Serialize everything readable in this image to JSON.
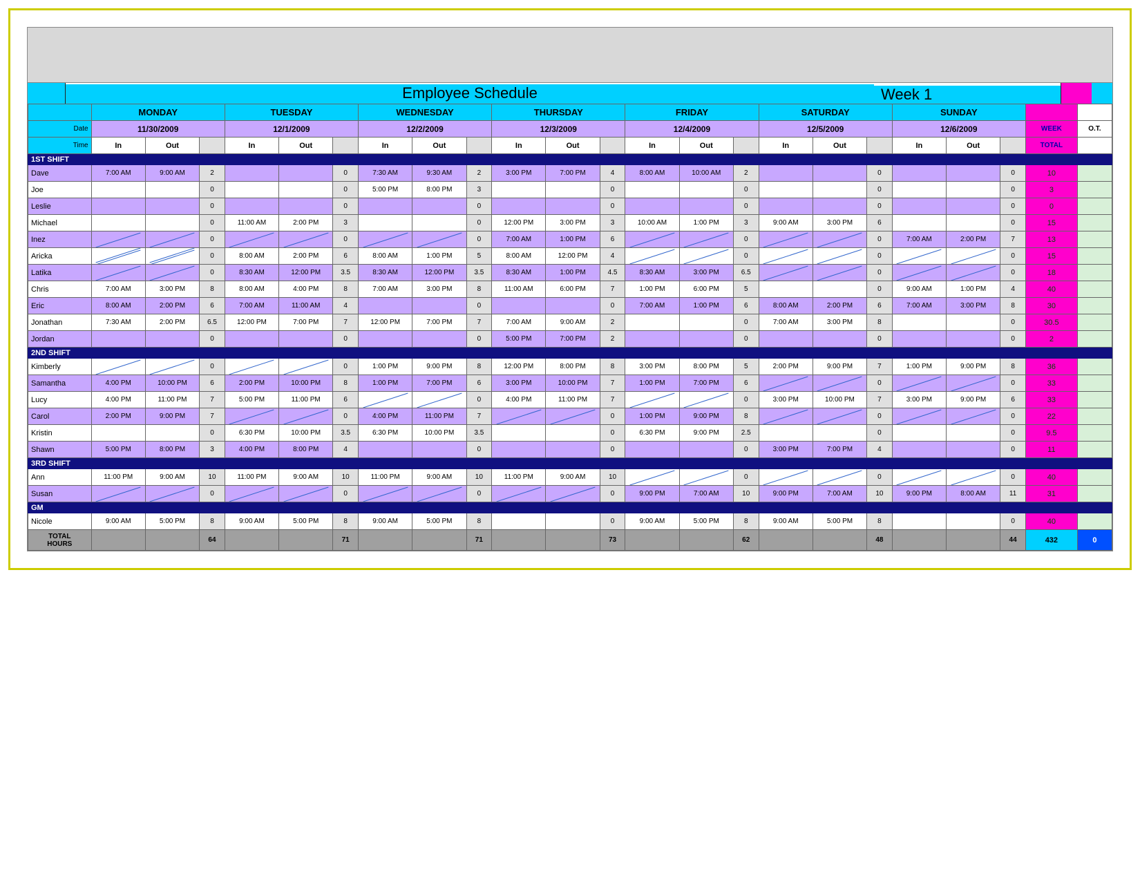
{
  "title": "Employee Schedule",
  "week_label": "Week 1",
  "labels": {
    "date": "Date",
    "time": "Time",
    "in": "In",
    "out": "Out",
    "week": "WEEK",
    "total": "TOTAL",
    "ot": "O.T.",
    "total_hours": "TOTAL HOURS"
  },
  "days": [
    {
      "name": "MONDAY",
      "date": "11/30/2009"
    },
    {
      "name": "TUESDAY",
      "date": "12/1/2009"
    },
    {
      "name": "WEDNESDAY",
      "date": "12/2/2009"
    },
    {
      "name": "THURSDAY",
      "date": "12/3/2009"
    },
    {
      "name": "FRIDAY",
      "date": "12/4/2009"
    },
    {
      "name": "SATURDAY",
      "date": "12/5/2009"
    },
    {
      "name": "SUNDAY",
      "date": "12/6/2009"
    }
  ],
  "shifts": [
    {
      "name": "1ST SHIFT",
      "rows": [
        {
          "name": "Dave",
          "cells": [
            [
              "7:00 AM",
              "9:00 AM",
              "2"
            ],
            [
              "",
              "",
              "0"
            ],
            [
              "7:30 AM",
              "9:30 AM",
              "2"
            ],
            [
              "3:00 PM",
              "7:00 PM",
              "4"
            ],
            [
              "8:00 AM",
              "10:00 AM",
              "2"
            ],
            [
              "",
              "",
              "0"
            ],
            [
              "",
              "",
              "0"
            ]
          ],
          "total": "10"
        },
        {
          "name": "Joe",
          "cells": [
            [
              "",
              "",
              "0"
            ],
            [
              "",
              "",
              "0"
            ],
            [
              "5:00 PM",
              "8:00 PM",
              "3"
            ],
            [
              "",
              "",
              "0"
            ],
            [
              "",
              "",
              "0"
            ],
            [
              "",
              "",
              "0"
            ],
            [
              "",
              "",
              "0"
            ]
          ],
          "total": "3"
        },
        {
          "name": "Leslie",
          "cells": [
            [
              "",
              "",
              "0"
            ],
            [
              "",
              "",
              "0"
            ],
            [
              "",
              "",
              "0"
            ],
            [
              "",
              "",
              "0"
            ],
            [
              "",
              "",
              "0"
            ],
            [
              "",
              "",
              "0"
            ],
            [
              "",
              "",
              "0"
            ]
          ],
          "total": "0"
        },
        {
          "name": "Michael",
          "cells": [
            [
              "",
              "",
              "0"
            ],
            [
              "11:00 AM",
              "2:00 PM",
              "3"
            ],
            [
              "",
              "",
              "0"
            ],
            [
              "12:00 PM",
              "3:00 PM",
              "3"
            ],
            [
              "10:00 AM",
              "1:00 PM",
              "3"
            ],
            [
              "9:00 AM",
              "3:00 PM",
              "6"
            ],
            [
              "",
              "",
              "0"
            ]
          ],
          "total": "15"
        },
        {
          "name": "Inez",
          "cells": [
            [
              "/",
              "/",
              "0"
            ],
            [
              "/",
              "/",
              "0"
            ],
            [
              "/",
              "/",
              "0"
            ],
            [
              "7:00 AM",
              "1:00 PM",
              "6"
            ],
            [
              "/",
              "/",
              "0"
            ],
            [
              "/",
              "/",
              "0"
            ],
            [
              "7:00 AM",
              "2:00 PM",
              "7"
            ]
          ],
          "total": "13"
        },
        {
          "name": "Aricka",
          "cells": [
            [
              "//",
              "//",
              "0"
            ],
            [
              "8:00 AM",
              "2:00 PM",
              "6"
            ],
            [
              "8:00 AM",
              "1:00 PM",
              "5"
            ],
            [
              "8:00 AM",
              "12:00 PM",
              "4"
            ],
            [
              "/",
              "/",
              "0"
            ],
            [
              "/",
              "/",
              "0"
            ],
            [
              "/",
              "/",
              "0"
            ]
          ],
          "total": "15"
        },
        {
          "name": "Latika",
          "cells": [
            [
              "/",
              "/",
              "0"
            ],
            [
              "8:30 AM",
              "12:00 PM",
              "3.5"
            ],
            [
              "8:30 AM",
              "12:00 PM",
              "3.5"
            ],
            [
              "8:30 AM",
              "1:00 PM",
              "4.5"
            ],
            [
              "8:30 AM",
              "3:00 PM",
              "6.5"
            ],
            [
              "/",
              "/",
              "0"
            ],
            [
              "/",
              "/",
              "0"
            ]
          ],
          "total": "18"
        },
        {
          "name": "Chris",
          "cells": [
            [
              "7:00 AM",
              "3:00 PM",
              "8"
            ],
            [
              "8:00 AM",
              "4:00 PM",
              "8"
            ],
            [
              "7:00 AM",
              "3:00 PM",
              "8"
            ],
            [
              "11:00 AM",
              "6:00 PM",
              "7"
            ],
            [
              "1:00 PM",
              "6:00 PM",
              "5"
            ],
            [
              "",
              "",
              "0"
            ],
            [
              "9:00 AM",
              "1:00 PM",
              "4"
            ]
          ],
          "total": "40"
        },
        {
          "name": "Eric",
          "cells": [
            [
              "8:00 AM",
              "2:00 PM",
              "6"
            ],
            [
              "7:00 AM",
              "11:00 AM",
              "4"
            ],
            [
              "",
              "",
              "0"
            ],
            [
              "",
              "",
              "0"
            ],
            [
              "7:00 AM",
              "1:00 PM",
              "6"
            ],
            [
              "8:00 AM",
              "2:00 PM",
              "6"
            ],
            [
              "7:00 AM",
              "3:00 PM",
              "8"
            ]
          ],
          "total": "30"
        },
        {
          "name": "Jonathan",
          "cells": [
            [
              "7:30 AM",
              "2:00 PM",
              "6.5"
            ],
            [
              "12:00 PM",
              "7:00 PM",
              "7"
            ],
            [
              "12:00 PM",
              "7:00 PM",
              "7"
            ],
            [
              "7:00 AM",
              "9:00 AM",
              "2"
            ],
            [
              "",
              "",
              "0"
            ],
            [
              "7:00 AM",
              "3:00 PM",
              "8"
            ],
            [
              "",
              "",
              "0"
            ]
          ],
          "total": "30.5"
        },
        {
          "name": "Jordan",
          "cells": [
            [
              "",
              "",
              "0"
            ],
            [
              "",
              "",
              "0"
            ],
            [
              "",
              "",
              "0"
            ],
            [
              "5:00 PM",
              "7:00 PM",
              "2"
            ],
            [
              "",
              "",
              "0"
            ],
            [
              "",
              "",
              "0"
            ],
            [
              "",
              "",
              "0"
            ]
          ],
          "total": "2"
        }
      ]
    },
    {
      "name": "2ND SHIFT",
      "rows": [
        {
          "name": "Kimberly",
          "cells": [
            [
              "/",
              "/",
              "0"
            ],
            [
              "/",
              "/",
              "0"
            ],
            [
              "1:00 PM",
              "9:00 PM",
              "8"
            ],
            [
              "12:00 PM",
              "8:00 PM",
              "8"
            ],
            [
              "3:00 PM",
              "8:00 PM",
              "5"
            ],
            [
              "2:00 PM",
              "9:00 PM",
              "7"
            ],
            [
              "1:00 PM",
              "9:00 PM",
              "8"
            ]
          ],
          "total": "36"
        },
        {
          "name": "Samantha",
          "cells": [
            [
              "4:00 PM",
              "10:00 PM",
              "6"
            ],
            [
              "2:00 PM",
              "10:00 PM",
              "8"
            ],
            [
              "1:00 PM",
              "7:00 PM",
              "6"
            ],
            [
              "3:00 PM",
              "10:00 PM",
              "7"
            ],
            [
              "1:00 PM",
              "7:00 PM",
              "6"
            ],
            [
              "/",
              "/",
              "0"
            ],
            [
              "/",
              "/",
              "0"
            ]
          ],
          "total": "33"
        },
        {
          "name": "Lucy",
          "cells": [
            [
              "4:00 PM",
              "11:00 PM",
              "7"
            ],
            [
              "5:00 PM",
              "11:00 PM",
              "6"
            ],
            [
              "/",
              "/",
              "0"
            ],
            [
              "4:00 PM",
              "11:00 PM",
              "7"
            ],
            [
              "/",
              "/",
              "0"
            ],
            [
              "3:00 PM",
              "10:00 PM",
              "7"
            ],
            [
              "3:00 PM",
              "9:00 PM",
              "6"
            ]
          ],
          "total": "33"
        },
        {
          "name": "Carol",
          "cells": [
            [
              "2:00 PM",
              "9:00 PM",
              "7"
            ],
            [
              "/",
              "/",
              "0"
            ],
            [
              "4:00 PM",
              "11:00 PM",
              "7"
            ],
            [
              "/",
              "/",
              "0"
            ],
            [
              "1:00 PM",
              "9:00 PM",
              "8"
            ],
            [
              "/",
              "/",
              "0"
            ],
            [
              "/",
              "/",
              "0"
            ]
          ],
          "total": "22"
        },
        {
          "name": "Kristin",
          "cells": [
            [
              "",
              "",
              "0"
            ],
            [
              "6:30 PM",
              "10:00 PM",
              "3.5"
            ],
            [
              "6:30 PM",
              "10:00 PM",
              "3.5"
            ],
            [
              "",
              "",
              "0"
            ],
            [
              "6:30 PM",
              "9:00 PM",
              "2.5"
            ],
            [
              "",
              "",
              "0"
            ],
            [
              "",
              "",
              "0"
            ]
          ],
          "total": "9.5"
        },
        {
          "name": "Shawn",
          "cells": [
            [
              "5:00 PM",
              "8:00 PM",
              "3"
            ],
            [
              "4:00 PM",
              "8:00 PM",
              "4"
            ],
            [
              "",
              "",
              "0"
            ],
            [
              "",
              "",
              "0"
            ],
            [
              "",
              "",
              "0"
            ],
            [
              "3:00 PM",
              "7:00 PM",
              "4"
            ],
            [
              "",
              "",
              "0"
            ]
          ],
          "total": "11"
        }
      ]
    },
    {
      "name": "3RD SHIFT",
      "rows": [
        {
          "name": "Ann",
          "cells": [
            [
              "11:00 PM",
              "9:00 AM",
              "10"
            ],
            [
              "11:00 PM",
              "9:00 AM",
              "10"
            ],
            [
              "11:00 PM",
              "9:00 AM",
              "10"
            ],
            [
              "11:00 PM",
              "9:00 AM",
              "10"
            ],
            [
              "/",
              "/",
              "0"
            ],
            [
              "/",
              "/",
              "0"
            ],
            [
              "/",
              "/",
              "0"
            ]
          ],
          "total": "40"
        },
        {
          "name": "Susan",
          "cells": [
            [
              "/",
              "/",
              "0"
            ],
            [
              "/",
              "/",
              "0"
            ],
            [
              "/",
              "/",
              "0"
            ],
            [
              "/",
              "/",
              "0"
            ],
            [
              "9:00 PM",
              "7:00 AM",
              "10"
            ],
            [
              "9:00 PM",
              "7:00 AM",
              "10"
            ],
            [
              "9:00 PM",
              "8:00 AM",
              "11"
            ]
          ],
          "total": "31"
        }
      ]
    },
    {
      "name": "GM",
      "rows": [
        {
          "name": "Nicole",
          "cells": [
            [
              "9:00 AM",
              "5:00 PM",
              "8"
            ],
            [
              "9:00 AM",
              "5:00 PM",
              "8"
            ],
            [
              "9:00 AM",
              "5:00 PM",
              "8"
            ],
            [
              "",
              "",
              "0"
            ],
            [
              "9:00 AM",
              "5:00 PM",
              "8"
            ],
            [
              "9:00 AM",
              "5:00 PM",
              "8"
            ],
            [
              "",
              "",
              "0"
            ]
          ],
          "total": "40"
        }
      ]
    }
  ],
  "day_totals": [
    "64",
    "71",
    "71",
    "73",
    "62",
    "48",
    "44"
  ],
  "grand_total": "432",
  "grand_ot": "0",
  "chart_data": {
    "type": "table",
    "title": "Employee Schedule — Week 1",
    "columns": [
      "Employee",
      "Mon In",
      "Mon Out",
      "Mon Hrs",
      "Tue In",
      "Tue Out",
      "Tue Hrs",
      "Wed In",
      "Wed Out",
      "Wed Hrs",
      "Thu In",
      "Thu Out",
      "Thu Hrs",
      "Fri In",
      "Fri Out",
      "Fri Hrs",
      "Sat In",
      "Sat Out",
      "Sat Hrs",
      "Sun In",
      "Sun Out",
      "Sun Hrs",
      "Week Total"
    ],
    "day_totals": {
      "Mon": 64,
      "Tue": 71,
      "Wed": 71,
      "Thu": 73,
      "Fri": 62,
      "Sat": 48,
      "Sun": 44
    },
    "grand_total": 432
  }
}
